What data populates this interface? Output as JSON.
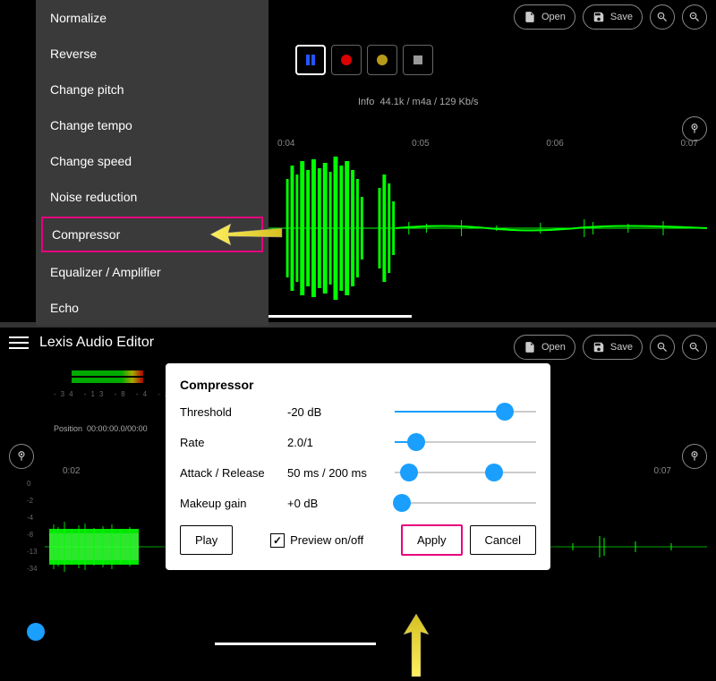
{
  "top": {
    "toolbar": {
      "open": "Open",
      "save": "Save"
    },
    "menu": [
      "Normalize",
      "Reverse",
      "Change pitch",
      "Change tempo",
      "Change speed",
      "Noise reduction",
      "Compressor",
      "Equalizer / Amplifier",
      "Echo"
    ],
    "highlighted_menu_index": 6,
    "info_label": "Info",
    "info_value": "44.1k / m4a / 129 Kb/s",
    "timeline": [
      "0:04",
      "0:05",
      "0:06",
      "0:07"
    ]
  },
  "bottom": {
    "app_title": "Lexis Audio Editor",
    "toolbar": {
      "open": "Open",
      "save": "Save"
    },
    "meter_scale": "-34 -13 -8 -4 -2 0",
    "position_label": "Position",
    "position_value": "00:00:00.0/00:00",
    "timeline": [
      "0:02",
      "0:07"
    ],
    "ylabels": [
      "0",
      "-2",
      "-4",
      "-8",
      "-13",
      "-34"
    ]
  },
  "dialog": {
    "title": "Compressor",
    "threshold": {
      "label": "Threshold",
      "value": "-20 dB",
      "pct": 78
    },
    "rate": {
      "label": "Rate",
      "value": "2.0/1",
      "pct": 15
    },
    "attack": {
      "label": "Attack / Release",
      "value": "50 ms  /  200 ms",
      "pct1": 10,
      "pct2": 70
    },
    "gain": {
      "label": "Makeup gain",
      "value": "+0 dB",
      "pct": 5
    },
    "play": "Play",
    "preview": "Preview on/off",
    "apply": "Apply",
    "cancel": "Cancel"
  }
}
